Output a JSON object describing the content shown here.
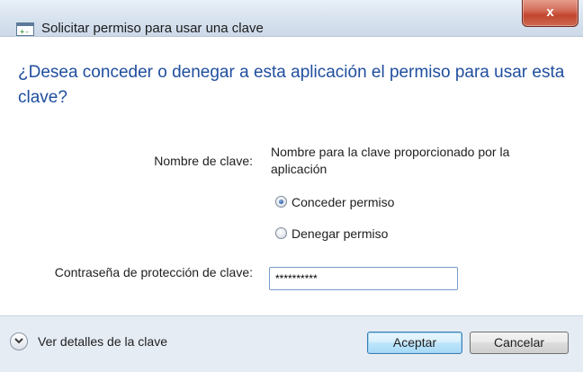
{
  "window": {
    "title": "Solicitar permiso para usar una clave",
    "close_glyph": "x",
    "icon": "key-window-icon",
    "app_icon_glyph": "+-"
  },
  "main": {
    "question": "¿Desea conceder o denegar a esta aplicación el permiso para usar esta clave?",
    "key_name_label": "Nombre de clave:",
    "key_name_value": "Nombre para la clave proporcionado por la aplicación",
    "permission_options": [
      {
        "label": "Conceder permiso",
        "selected": true
      },
      {
        "label": "Denegar permiso",
        "selected": false
      }
    ],
    "password_label": "Contraseña de protección de clave:",
    "password_value": "**********"
  },
  "footer": {
    "details_label": "Ver detalles de la clave",
    "details_icon": "chevron-down-icon",
    "accept_label": "Aceptar",
    "cancel_label": "Cancelar"
  },
  "colors": {
    "question": "#1f4e9e",
    "close_button": "#c2462f",
    "footer_bg": "#e6ecf4"
  }
}
